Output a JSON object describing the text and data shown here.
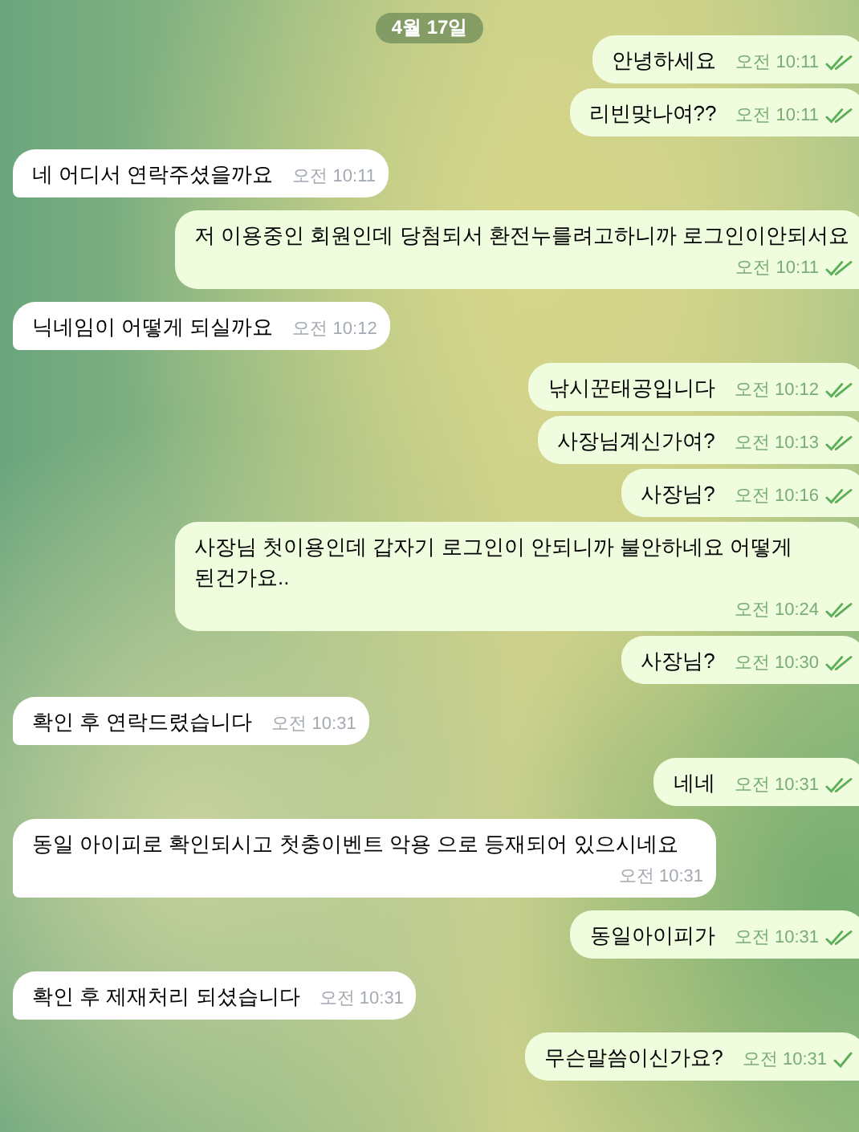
{
  "date_badge": "4월 17일",
  "messages": [
    {
      "kind": "sent",
      "text": "안녕하세요",
      "time": "오전 10:11",
      "read": true
    },
    {
      "kind": "sent",
      "text": "리빈맞나여??",
      "time": "오전 10:11",
      "read": true
    },
    {
      "kind": "received",
      "text": "네 어디서 연락주셨을까요",
      "time": "오전 10:11"
    },
    {
      "kind": "sent",
      "text": "저 이용중인 회원인데 당첨되서 환전누를려고하니까 로그인이안되서요",
      "time": "오전 10:11",
      "read": true
    },
    {
      "kind": "received",
      "text": "닉네임이 어떻게 되실까요",
      "time": "오전 10:12"
    },
    {
      "kind": "sent",
      "text": "낚시꾼태공입니다",
      "time": "오전 10:12",
      "read": true
    },
    {
      "kind": "sent",
      "text": "사장님계신가여?",
      "time": "오전 10:13",
      "read": true
    },
    {
      "kind": "sent",
      "text": "사장님?",
      "time": "오전 10:16",
      "read": true
    },
    {
      "kind": "sent",
      "text": "사장님 첫이용인데 갑자기 로그인이 안되니까 불안하네요 어떻게 된건가요..",
      "time": "오전 10:24",
      "read": true
    },
    {
      "kind": "sent",
      "text": "사장님?",
      "time": "오전 10:30",
      "read": true
    },
    {
      "kind": "received",
      "text": "확인 후 연락드렸습니다",
      "time": "오전 10:31"
    },
    {
      "kind": "sent",
      "text": "네네",
      "time": "오전 10:31",
      "read": true
    },
    {
      "kind": "received",
      "text": "동일 아이피로 확인되시고 첫충이벤트 악용 으로 등재되어 있으시네요",
      "time": "오전 10:31"
    },
    {
      "kind": "sent",
      "text": "동일아이피가",
      "time": "오전 10:31",
      "read": true
    },
    {
      "kind": "received",
      "text": "확인 후 제재처리 되셨습니다",
      "time": "오전 10:31"
    },
    {
      "kind": "sent",
      "text": "무슨말씀이신가요?",
      "time": "오전 10:31",
      "read": false
    }
  ]
}
